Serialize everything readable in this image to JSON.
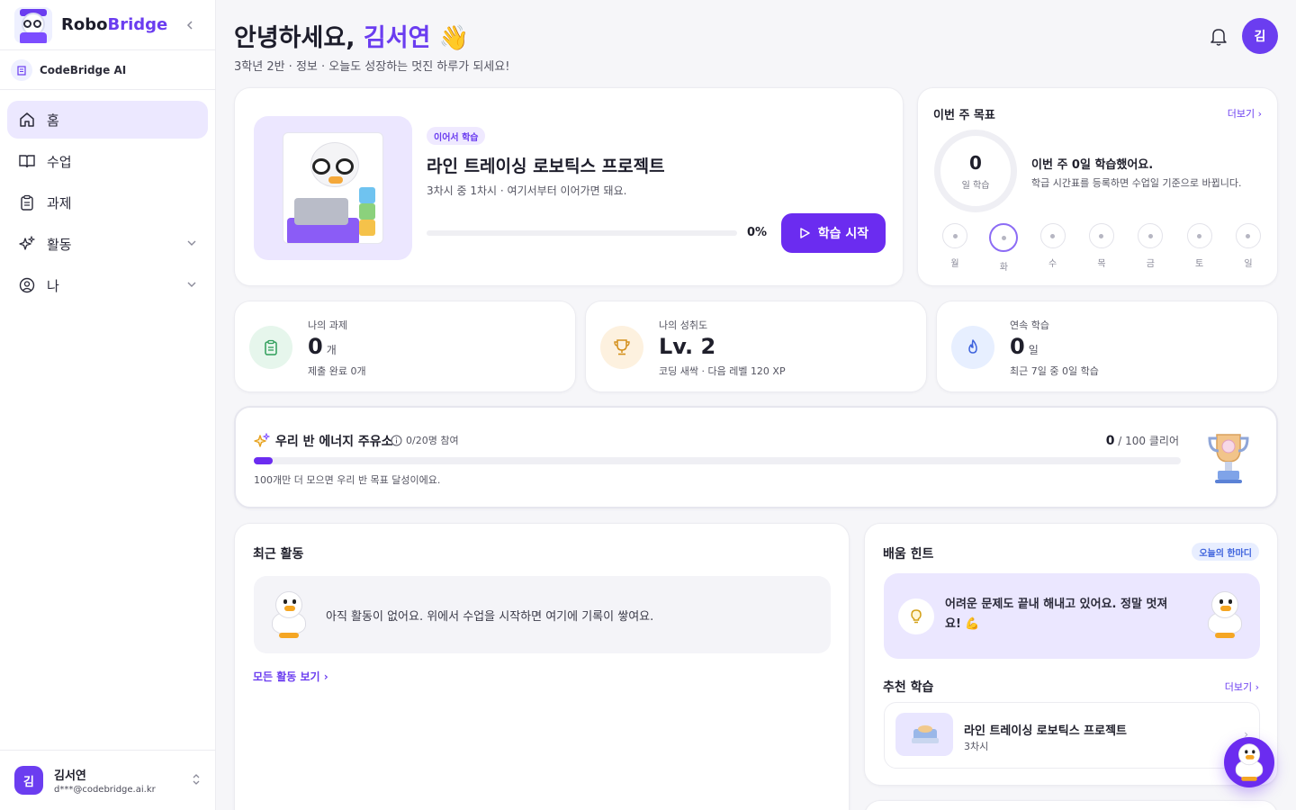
{
  "brand": {
    "name_prefix": "Robo",
    "name_suffix": "Bridge"
  },
  "workspace": {
    "label": "CodeBridge AI"
  },
  "sidebar": {
    "items": [
      {
        "label": "홈",
        "icon": "home-icon",
        "active": true
      },
      {
        "label": "수업",
        "icon": "book-icon"
      },
      {
        "label": "과제",
        "icon": "clipboard-icon"
      },
      {
        "label": "활동",
        "icon": "sparkle-icon",
        "expandable": true
      },
      {
        "label": "나",
        "icon": "user-circle-icon",
        "expandable": true
      }
    ]
  },
  "user": {
    "initial": "김",
    "name": "김서연",
    "email": "d***@codebridge.ai.kr"
  },
  "header": {
    "greeting": "안녕하세요, ",
    "name": "김서연",
    "emoji": "👋",
    "subtitle": "3학년 2반 · 정보 · 오늘도 성장하는 멋진 하루가 되세요!"
  },
  "continue_learning": {
    "tag": "이어서 학습",
    "title": "라인 트레이싱 로보틱스 프로젝트",
    "subtitle": "3차시 중 1차시 · 여기서부터 이어가면 돼요.",
    "progress": 0,
    "progress_label": "0%",
    "button": "학습 시작"
  },
  "weekly_goal": {
    "title": "이번 주 목표",
    "more": "더보기 ›",
    "count": "0",
    "unit": "일 학습",
    "message": "이번 주 0일 학습했어요.",
    "hint": "학급 시간표를 등록하면 수업일 기준으로 바뀝니다.",
    "days": [
      "월",
      "화",
      "수",
      "목",
      "금",
      "토",
      "일"
    ],
    "today_index": 1
  },
  "stats": [
    {
      "label": "나의 과제",
      "value": "0",
      "unit": "개",
      "sub": "제출 완료 0개",
      "icon": "clipboard-icon",
      "color": "#e6f6ec",
      "icon_color": "#2f9e5a"
    },
    {
      "label": "나의 성취도",
      "value": "Lv. 2",
      "unit": "",
      "sub": "코딩 새싹 · 다음 레벨 120 XP",
      "icon": "trophy-icon",
      "color": "#fdf1df",
      "icon_color": "#d4901c"
    },
    {
      "label": "연속 학습",
      "value": "0",
      "unit": "일",
      "sub": "최근 7일 중 0일 학습",
      "icon": "flame-icon",
      "color": "#e7efff",
      "icon_color": "#3e63dd"
    }
  ],
  "energy": {
    "title": "우리 반 에너지 주유소",
    "participation": "0/20명 참여",
    "current": "0",
    "goal": "/ 100 클리어",
    "fill": 0.02,
    "note": "100개만 더 모으면 우리 반 목표 달성이에요."
  },
  "recent": {
    "title": "최근 활동",
    "empty": "아직 활동이 없어요. 위에서 수업을 시작하면 여기에 기록이 쌓여요.",
    "link": "모든 활동 보기 ›"
  },
  "tips": {
    "title": "배움 힌트",
    "badge": "오늘의 한마디",
    "message": "어려운 문제도 끝내 해내고 있어요. 정말 멋져요! 💪",
    "rec_title": "추천 학습",
    "rec_more": "더보기 ›",
    "rec_item_title": "라인 트레이싱 로보틱스 프로젝트",
    "rec_item_sub": "3차시"
  },
  "colors": {
    "accent": "#6b2cf0",
    "accent_light": "#ece8ff"
  }
}
